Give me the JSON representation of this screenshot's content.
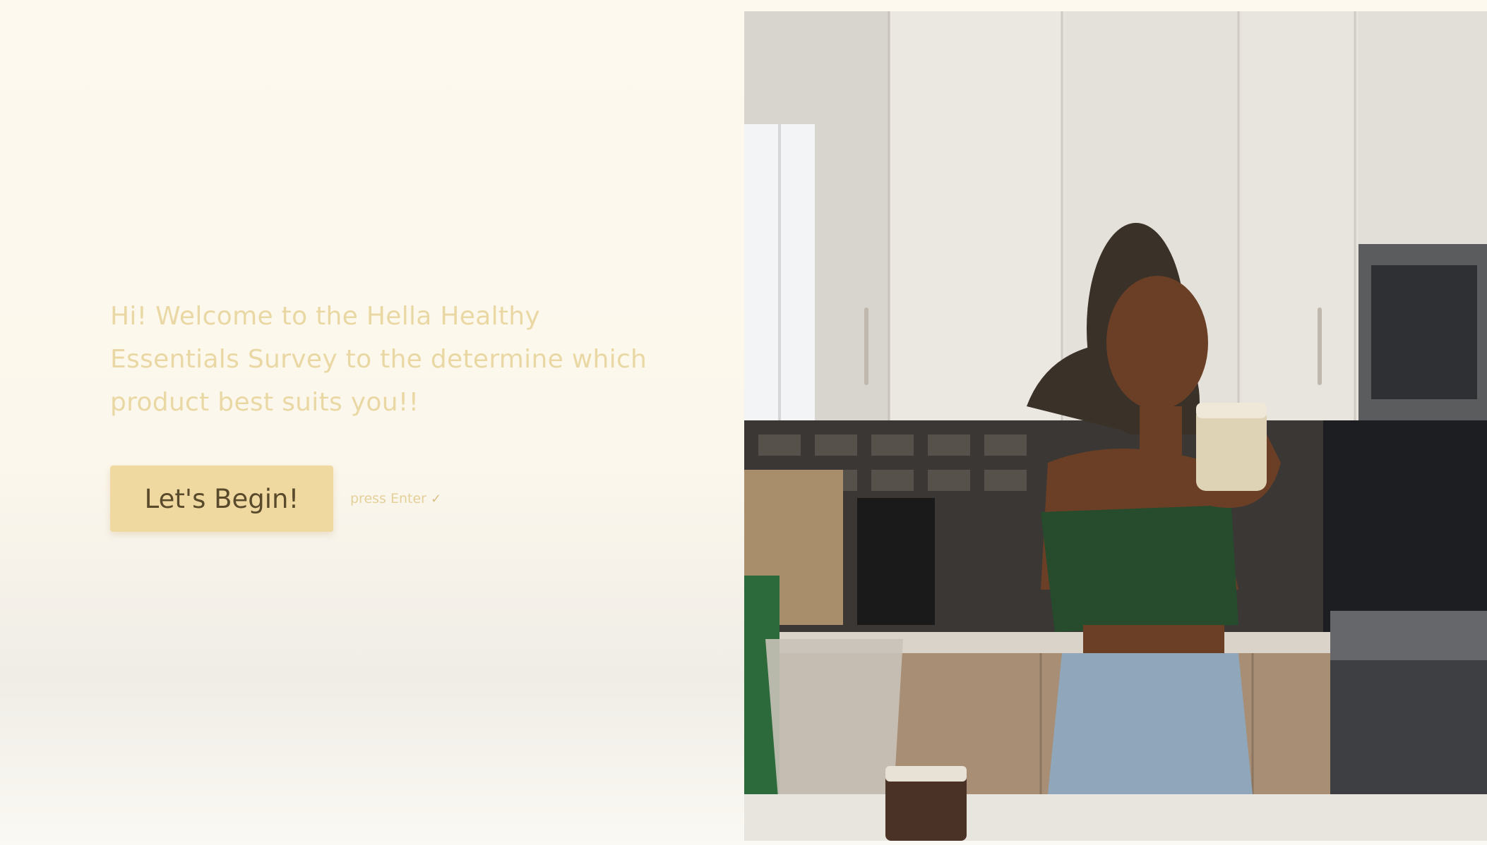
{
  "welcome": {
    "message": "Hi! Welcome to the Hella Healthy Essentials Survey to the determine which product best suits you!!"
  },
  "cta": {
    "button_label": "Let's Begin!",
    "hint_text": "press Enter",
    "hint_icon": "enter-check-icon"
  },
  "colors": {
    "background": "#fcf9f0",
    "accent": "#f0d9a1",
    "text_accent": "#ead8a4",
    "button_text": "#5a4a2c"
  }
}
